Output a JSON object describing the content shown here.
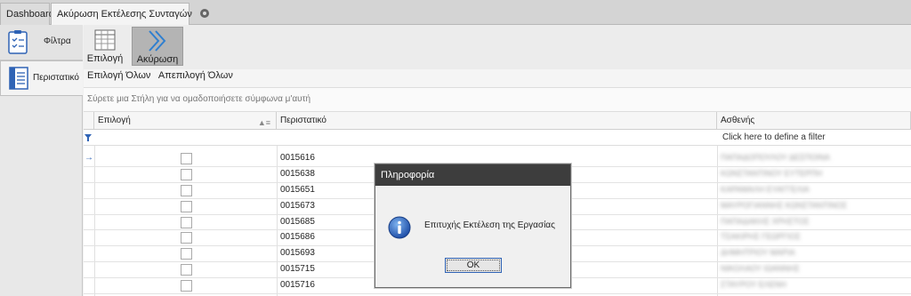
{
  "tabs": [
    {
      "label": "Dashboard"
    },
    {
      "label": "Ακύρωση Εκτέλεσης Συνταγών"
    }
  ],
  "sidebar": {
    "items": [
      {
        "label": "Φίλτρα",
        "icon": "clipboard-icon"
      },
      {
        "label": "Περιστατικό",
        "icon": "document-list-icon"
      }
    ]
  },
  "ribbon": {
    "select_label": "Επιλογή",
    "cancel_label": "Ακύρωση",
    "select_all": "Επιλογή Όλων",
    "deselect_all": "Απεπιλογή Όλων"
  },
  "group_panel_text": "Σύρετε μια Στήλη για να ομαδοποιήσετε σύμφωνα μ'αυτή",
  "grid": {
    "columns": [
      "Επιλογή",
      "Περιστατικό",
      "Ασθενής"
    ],
    "filter_hint": "Click here to define a filter",
    "rows": [
      {
        "code": "0015616",
        "patient": "ΠΑΠΑΔΟΠΟΥΛΟΥ ΔΕΣΠΟΙΝΑ"
      },
      {
        "code": "0015638",
        "patient": "ΚΩΝΣΤΑΝΤΙΝΟΥ ΕΥΤΕΡΠΗ"
      },
      {
        "code": "0015651",
        "patient": "ΚΑΡΑΜΑΛΗ ΕΥΑΓΓΕΛΙΑ"
      },
      {
        "code": "0015673",
        "patient": "ΜΑΥΡΟΓΙΑΝΝΗΣ ΚΩΝΣΤΑΝΤΙΝΟΣ"
      },
      {
        "code": "0015685",
        "patient": "ΠΑΠΑΔΑΚΗΣ ΧΡΗΣΤΟΣ"
      },
      {
        "code": "0015686",
        "patient": "ΤΣΑΚΙΡΗΣ ΓΕΩΡΓΙΟΣ"
      },
      {
        "code": "0015693",
        "patient": "ΔΗΜΗΤΡΙΟΥ ΜΑΡΙΑ"
      },
      {
        "code": "0015715",
        "patient": "ΝΙΚΟΛΑΟΥ ΙΩΑΝΝΗΣ"
      },
      {
        "code": "0015716",
        "patient": "ΣΤΑΥΡΟΥ ΕΛΕΝΗ"
      }
    ]
  },
  "dialog": {
    "title": "Πληροφορία",
    "message": "Επιτυχής Εκτέλεση της Εργασίας",
    "ok_label": "OK",
    "icon": "info-icon"
  },
  "colors": {
    "accent": "#2f63b5",
    "dialog_title_bg": "#3d3d3d"
  }
}
